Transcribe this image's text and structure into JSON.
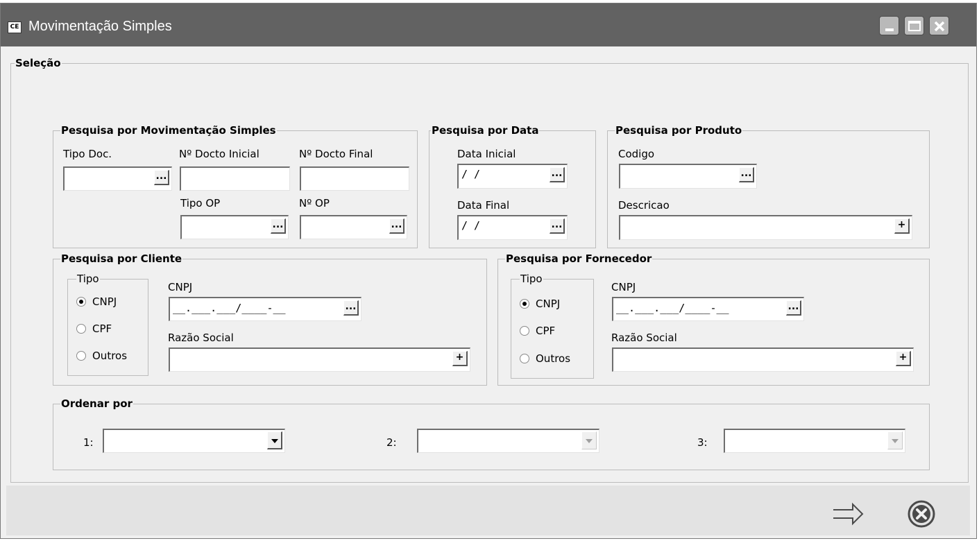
{
  "window": {
    "title": "Movimentação Simples",
    "app_icon_text": "CE"
  },
  "selection": {
    "legend": "Seleção"
  },
  "movimentacao": {
    "legend": "Pesquisa por Movimentação Simples",
    "tipo_doc_label": "Tipo Doc.",
    "docto_inicial_label": "Nº Docto Inicial",
    "docto_final_label": "Nº Docto Final",
    "tipo_op_label": "Tipo OP",
    "num_op_label": "Nº OP"
  },
  "data": {
    "legend": "Pesquisa por Data",
    "data_inicial_label": "Data Inicial",
    "data_inicial_value": "/ /",
    "data_final_label": "Data Final",
    "data_final_value": "/ /"
  },
  "produto": {
    "legend": "Pesquisa por Produto",
    "codigo_label": "Codigo",
    "descricao_label": "Descricao"
  },
  "cliente": {
    "legend": "Pesquisa por Cliente",
    "tipo_legend": "Tipo",
    "radio_cnpj": "CNPJ",
    "radio_cpf": "CPF",
    "radio_outros": "Outros",
    "selected": "CNPJ",
    "cnpj_label": "CNPJ",
    "cnpj_value": "__.___.___/____-__",
    "razao_label": "Razão Social"
  },
  "fornecedor": {
    "legend": "Pesquisa por Fornecedor",
    "tipo_legend": "Tipo",
    "radio_cnpj": "CNPJ",
    "radio_cpf": "CPF",
    "radio_outros": "Outros",
    "selected": "CNPJ",
    "cnpj_label": "CNPJ",
    "cnpj_value": "__.___.___/____-__",
    "razao_label": "Razão Social"
  },
  "ordenar": {
    "legend": "Ordenar por",
    "label_1": "1:",
    "label_2": "2:",
    "label_3": "3:"
  },
  "buttons": {
    "ellipsis": "...",
    "plus": "+"
  },
  "icons": {
    "minimize": "minimize-icon",
    "maximize": "maximize-icon",
    "close": "close-icon",
    "confirm": "arrow-right-icon",
    "cancel": "cancel-circle-icon"
  },
  "colors": {
    "titlebar": "#626262",
    "window_bg": "#f0f0f0",
    "bottom_bar": "#e3e3e3"
  }
}
